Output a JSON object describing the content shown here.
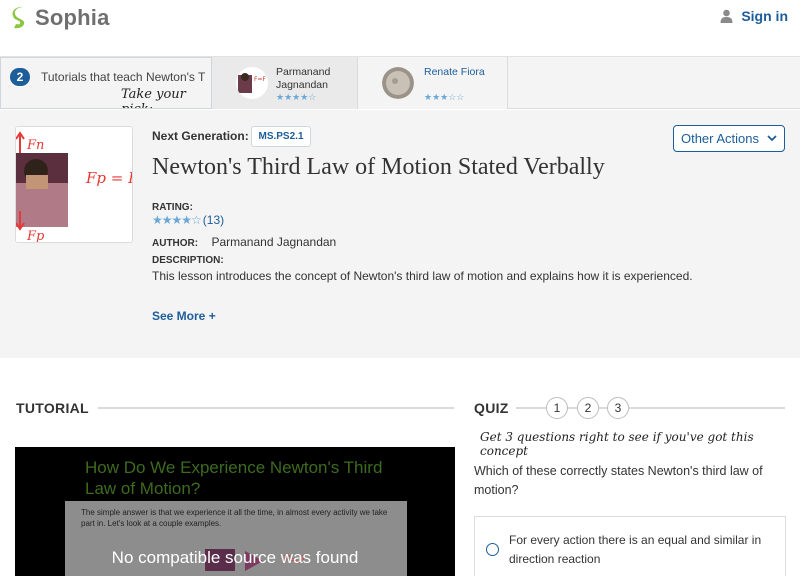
{
  "header": {
    "logo_text": "Sophia",
    "signin_label": "Sign in"
  },
  "strip": {
    "count": "2",
    "label": "Tutorials that teach Newton's T",
    "pick_text": "Take your pick:",
    "tutorials": [
      {
        "name_line1": "Parmanand",
        "name_line2": "Jagnandan",
        "rating": 4,
        "stars": "★★★★☆"
      },
      {
        "name_line1": "Renate Fiora",
        "name_line2": "",
        "rating": 2.5,
        "stars": "★★★☆☆"
      }
    ]
  },
  "lesson": {
    "ng_label": "Next Generation:",
    "ng_badge": "MS.PS2.1",
    "title": "Newton's Third Law of Motion Stated Verbally",
    "other_actions": "Other Actions",
    "rating_label": "RATING:",
    "rating_stars": "★★★★☆",
    "rating_value": 4,
    "rating_count": "(13)",
    "author_label": "AUTHOR:",
    "author_name": "Parmanand Jagnandan",
    "desc_label": "DESCRIPTION:",
    "desc_text": "This lesson introduces the concept of Newton's third law of motion and explains how it is experienced.",
    "see_more": "See More +",
    "thumb_labels": {
      "top": "Fn",
      "eq": "Fp = Fn",
      "bottom": "Fp"
    }
  },
  "tutorial": {
    "section_title": "TUTORIAL",
    "slide_title": "How Do We Experience Newton's Third Law of Motion?",
    "slide_body": "The simple answer is that we experience it all the time, in almost every activity we take part in. Let's look at a couple examples.",
    "video_message": "No compatible source was found"
  },
  "quiz": {
    "section_title": "QUIZ",
    "question_numbers": [
      "1",
      "2",
      "3"
    ],
    "hint": "Get 3 questions right to see if you've got this concept",
    "question": "Which of these correctly states Newton's third law of motion?",
    "option_1": "For every action there is an equal and similar in direction reaction"
  },
  "colors": {
    "brand_blue": "#1c5d9a",
    "logo_green": "#8cc63f",
    "star_blue": "#6aa8d8"
  }
}
